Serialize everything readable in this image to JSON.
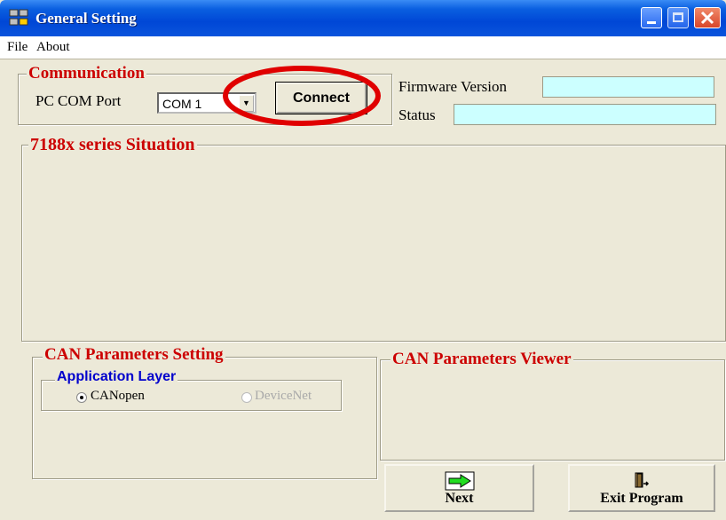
{
  "window": {
    "title": "General Setting"
  },
  "menu": {
    "file": "File",
    "about": "About"
  },
  "communication": {
    "legend": "Communication",
    "com_port_label": "PC COM Port",
    "com_port_value": "COM 1",
    "connect_label": "Connect"
  },
  "firmware": {
    "label": "Firmware Version",
    "value": ""
  },
  "status": {
    "label": "Status",
    "value": ""
  },
  "situation": {
    "legend": "7188x series Situation"
  },
  "can_settings": {
    "legend": "CAN Parameters Setting",
    "app_layer_legend": "Application Layer",
    "option_canopen": "CANopen",
    "option_devicenet": "DeviceNet"
  },
  "can_viewer": {
    "legend": "CAN Parameters Viewer"
  },
  "buttons": {
    "next": "Next",
    "exit": "Exit Program"
  },
  "colors": {
    "highlight_ellipse": "#e00000",
    "field_bg": "#ccffff",
    "legend_red": "#cc0000",
    "legend_blue": "#0000cc"
  },
  "icons": [
    "app-icon",
    "minimize-icon",
    "maximize-icon",
    "close-icon",
    "dropdown-arrow-icon",
    "next-arrow-icon",
    "exit-door-icon"
  ]
}
